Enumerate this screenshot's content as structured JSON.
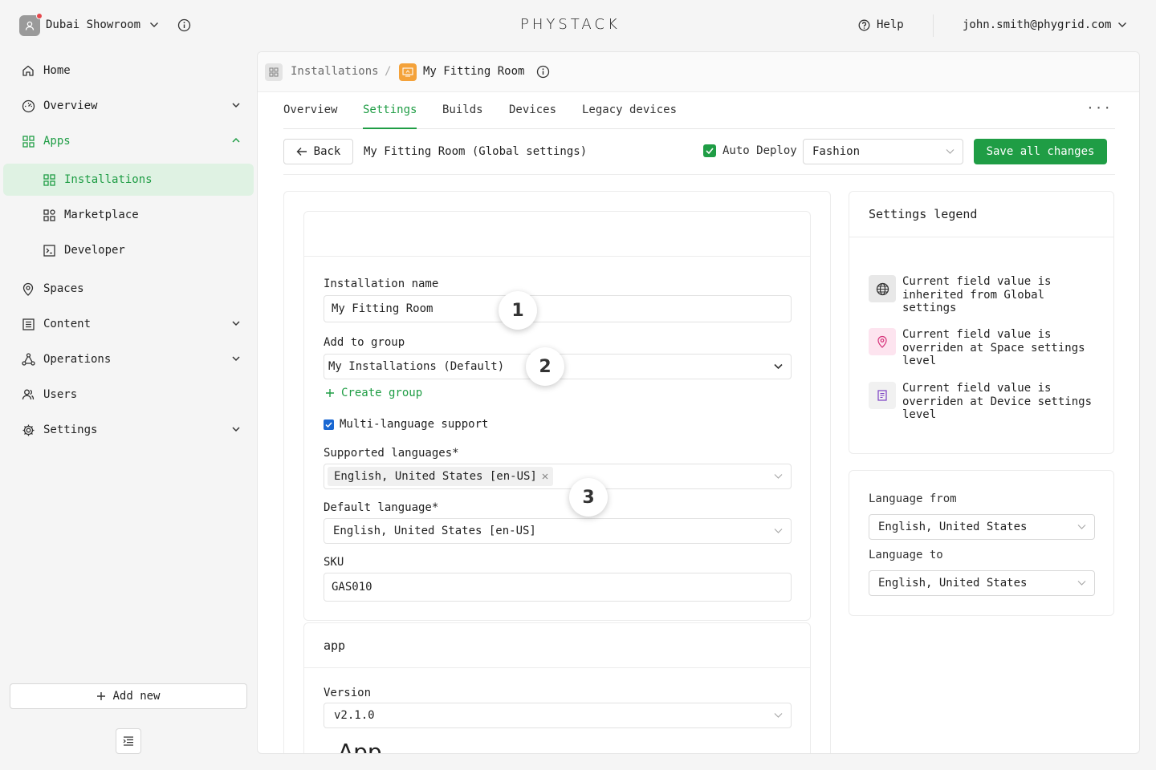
{
  "workspace": {
    "name": "Dubai Showroom"
  },
  "brand": {
    "name": "PHYSTACK"
  },
  "topbar": {
    "help_label": "Help",
    "user_email": "john.smith@phygrid.com"
  },
  "sidebar": {
    "items": [
      {
        "label": "Home",
        "icon": "home-icon"
      },
      {
        "label": "Overview",
        "icon": "dashboard-icon"
      },
      {
        "label": "Apps",
        "icon": "apps-icon"
      },
      {
        "label": "Installations",
        "icon": "installations-icon"
      },
      {
        "label": "Marketplace",
        "icon": "marketplace-icon"
      },
      {
        "label": "Developer",
        "icon": "terminal-icon"
      },
      {
        "label": "Spaces",
        "icon": "location-pin-icon"
      },
      {
        "label": "Content",
        "icon": "content-icon"
      },
      {
        "label": "Operations",
        "icon": "operations-icon"
      },
      {
        "label": "Users",
        "icon": "users-icon"
      },
      {
        "label": "Settings",
        "icon": "gear-icon"
      }
    ],
    "add_new_label": "Add new"
  },
  "breadcrumb": {
    "root": "Installations",
    "separator": "/",
    "current": "My Fitting Room"
  },
  "tabs": [
    "Overview",
    "Settings",
    "Builds",
    "Devices",
    "Legacy devices"
  ],
  "toolbar": {
    "back_label": "Back",
    "title": "My Fitting Room (Global settings)",
    "auto_deploy_label": "Auto Deploy",
    "theme_value": "Fashion",
    "save_label": "Save all changes"
  },
  "form": {
    "installation_name_label": "Installation name",
    "installation_name_value": "My Fitting Room",
    "group_label": "Add to group",
    "group_value": "My Installations (Default)",
    "create_group_label": "Create group",
    "multi_language_label": "Multi-language support",
    "supported_languages_label": "Supported languages*",
    "supported_language_tag": "English, United States [en-US]",
    "default_language_label": "Default language*",
    "default_language_value": "English, United States [en-US]",
    "sku_label": "SKU",
    "sku_value": "GAS010",
    "app_section_title": "app",
    "version_label": "Version",
    "version_value": "v2.1.0",
    "app_heading": "App"
  },
  "markers": [
    "1",
    "2",
    "3"
  ],
  "legend": {
    "title": "Settings legend",
    "items": [
      {
        "text": "Current field value is inherited from Global settings",
        "icon": "globe-icon",
        "bg": "#ececec"
      },
      {
        "text": "Current field value is overriden at Space settings level",
        "icon": "location-pin-icon",
        "bg": "#fde4ef"
      },
      {
        "text": "Current field value is overriden at Device settings level",
        "icon": "device-icon",
        "bg": "#f1f1f1"
      }
    ]
  },
  "language": {
    "from_label": "Language from",
    "from_value": "English, United States",
    "to_label": "Language to",
    "to_value": "English, United States"
  },
  "colors": {
    "accent": "#1f9d45",
    "accent_light": "#dff2e3",
    "checkbox_blue": "#1967d2",
    "breadcrumb_app": "#f4a23a"
  }
}
